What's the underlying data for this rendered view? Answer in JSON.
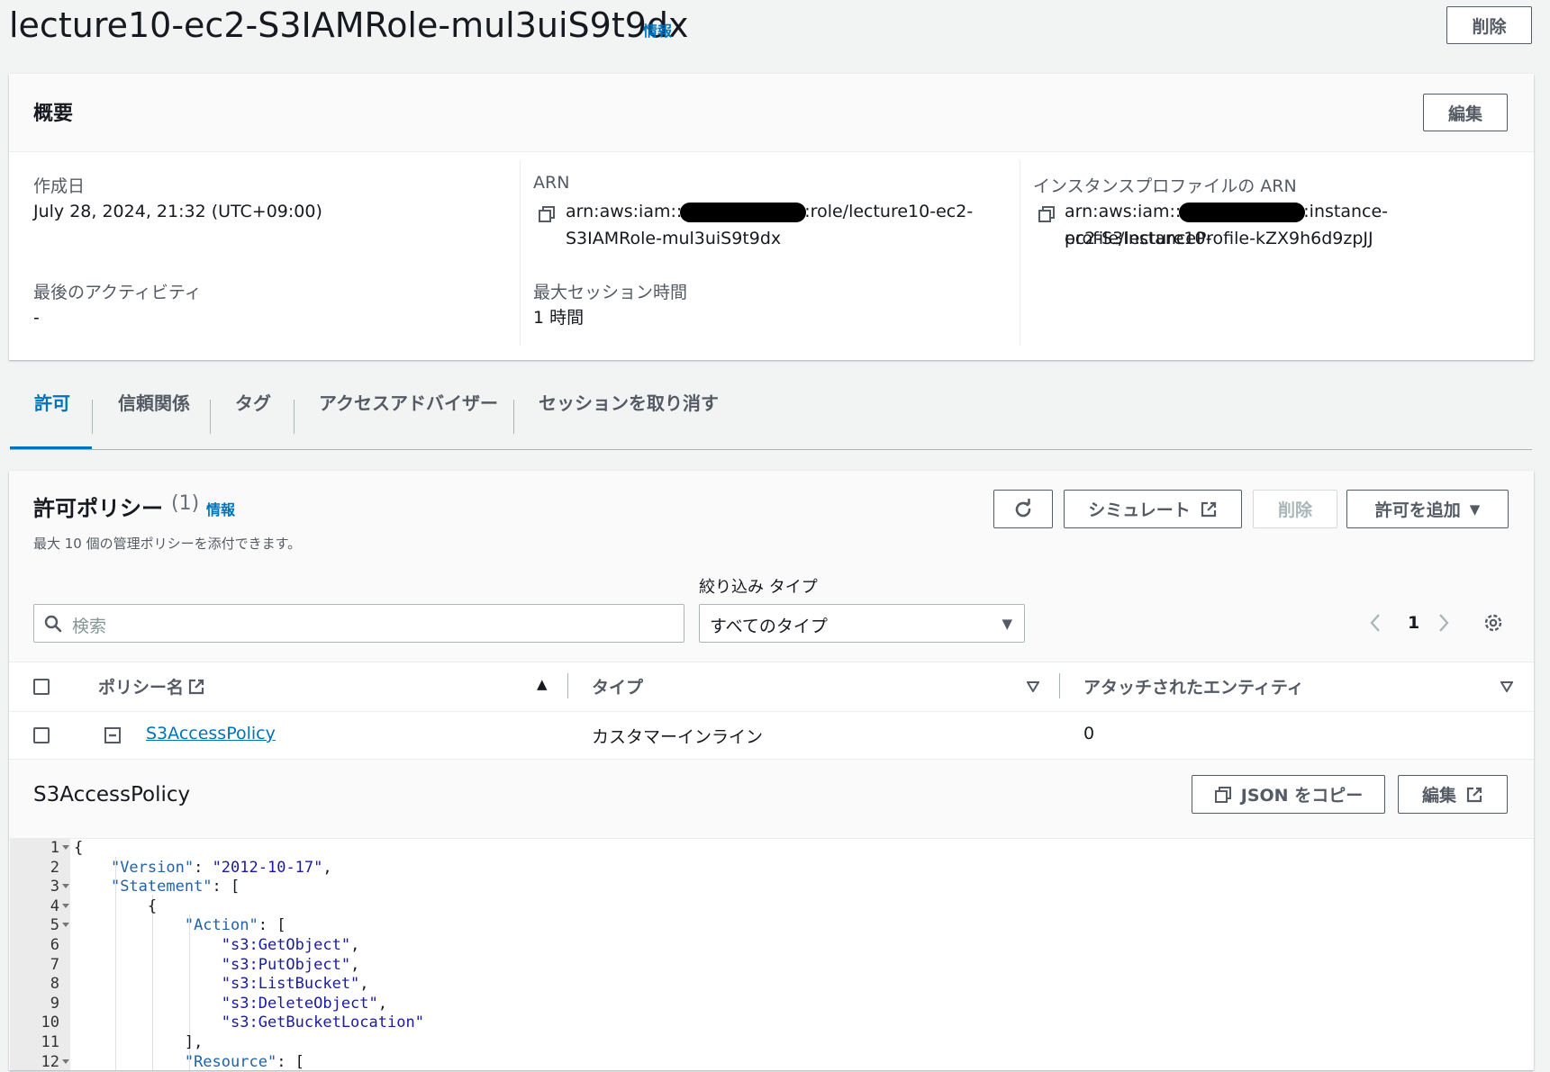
{
  "page": {
    "title": "lecture10-ec2-S3IAMRole-mul3uiS9t9dx",
    "info_link": "情報",
    "delete_button": "削除"
  },
  "summary": {
    "heading": "概要",
    "edit_button": "編集",
    "created_label": "作成日",
    "created_value": "July 28, 2024, 21:32 (UTC+09:00)",
    "last_activity_label": "最後のアクティビティ",
    "last_activity_value": "-",
    "arn_label": "ARN",
    "arn_prefix": "arn:aws:iam::",
    "arn_suffix": ":role/lecture10-ec2-",
    "arn_line2": "S3IAMRole-mul3uiS9t9dx",
    "max_session_label": "最大セッション時間",
    "max_session_value": "1 時間",
    "instance_profile_label": "インスタンスプロファイルの ARN",
    "instance_profile_prefix": "arn:aws:iam::",
    "instance_profile_suffix": ":instance-profile/lecture10-",
    "instance_profile_line2": "ec2-S3InstanceProfile-kZX9h6d9zpJJ"
  },
  "tabs": [
    "許可",
    "信頼関係",
    "タグ",
    "アクセスアドバイザー",
    "セッションを取り消す"
  ],
  "policies": {
    "heading": "許可ポリシー",
    "count": "(1)",
    "info_link": "情報",
    "description": "最大 10 個の管理ポリシーを添付できます。",
    "refresh_icon": "refresh-icon",
    "simulate_button": "シミュレート",
    "delete_button": "削除",
    "add_button": "許可を追加",
    "filter_label": "絞り込み タイプ",
    "search_placeholder": "検索",
    "filter_value": "すべてのタイプ",
    "page_number": "1",
    "columns": [
      "ポリシー名",
      "タイプ",
      "アタッチされたエンティティ"
    ],
    "rows": [
      {
        "name": "S3AccessPolicy",
        "type": "カスタマーインライン",
        "entities": "0"
      }
    ]
  },
  "detail": {
    "title": "S3AccessPolicy",
    "copy_json_button": "JSON をコピー",
    "edit_button": "編集",
    "line_numbers": [
      "1",
      "2",
      "3",
      "4",
      "5",
      "6",
      "7",
      "8",
      "9",
      "10",
      "11",
      "12"
    ],
    "folding_lines": [
      "1",
      "3",
      "4",
      "5",
      "12"
    ]
  },
  "colors": {
    "accent": "#0073bb",
    "text": "#16191f",
    "muted": "#545b64",
    "background": "#f2f3f3"
  }
}
